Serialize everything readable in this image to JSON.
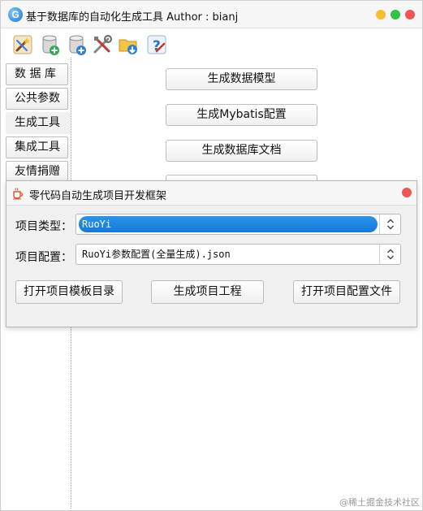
{
  "app": {
    "title": "基于数据库的自动化生成工具  Author : bianj",
    "logo_letter": "G",
    "window_controls": [
      "minimize",
      "maximize",
      "close"
    ],
    "window_control_colors": {
      "minimize": "#f6bd2e",
      "maximize": "#2fc541",
      "close": "#f15552"
    }
  },
  "toolbar": {
    "icons": [
      "magic-wand-icon",
      "database-add-icon",
      "database-settings-icon",
      "tools-icon",
      "folder-download-icon",
      "help-icon"
    ]
  },
  "sidebar": {
    "items": [
      {
        "label": "数 据 库"
      },
      {
        "label": "公共参数"
      },
      {
        "label": "生成工具",
        "active": true
      },
      {
        "label": "集成工具"
      },
      {
        "label": "友情捐赠"
      }
    ]
  },
  "main": {
    "actions": [
      {
        "label": "生成数据模型"
      },
      {
        "label": "生成Mybatis配置"
      },
      {
        "label": "生成数据库文档"
      },
      {
        "label": ""
      }
    ]
  },
  "dialog": {
    "title": "零代码自动生成项目开发框架",
    "icon": "coffee-cup-icon",
    "project_type": {
      "label": "项目类型：",
      "value": "RuoYi"
    },
    "project_config": {
      "label": "项目配置：",
      "value": "RuoYi参数配置(全量生成).json"
    },
    "buttons": {
      "open_template_dir": "打开项目模板目录",
      "generate_project": "生成项目工程",
      "open_config_file": "打开项目配置文件"
    },
    "accent_color": "#1478d8"
  },
  "watermark": "@稀土掘金技术社区"
}
